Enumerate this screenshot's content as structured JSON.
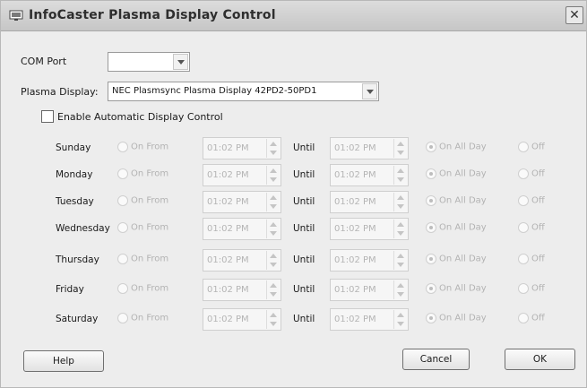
{
  "window": {
    "title": "InfoCaster Plasma Display Control",
    "close_label": "✕"
  },
  "com_port": {
    "label": "COM Port",
    "value": ""
  },
  "plasma_display": {
    "label": "Plasma Display:",
    "value": "NEC Plasmsync Plasma Display 42PD2-50PD1"
  },
  "enable_auto": {
    "label": "Enable Automatic Display Control",
    "checked": false
  },
  "schedule_labels": {
    "on_from": "On From",
    "until": "Until",
    "on_all_day": "On All Day",
    "off": "Off"
  },
  "days": [
    {
      "name": "Sunday",
      "from": "01:02 PM",
      "until": "01:02 PM",
      "mode": "on_all_day"
    },
    {
      "name": "Monday",
      "from": "01:02 PM",
      "until": "01:02 PM",
      "mode": "on_all_day"
    },
    {
      "name": "Tuesday",
      "from": "01:02 PM",
      "until": "01:02 PM",
      "mode": "on_all_day"
    },
    {
      "name": "Wednesday",
      "from": "01:02 PM",
      "until": "01:02 PM",
      "mode": "on_all_day"
    },
    {
      "name": "Thursday",
      "from": "01:02 PM",
      "until": "01:02 PM",
      "mode": "on_all_day"
    },
    {
      "name": "Friday",
      "from": "01:02 PM",
      "until": "01:02 PM",
      "mode": "on_all_day"
    },
    {
      "name": "Saturday",
      "from": "01:02 PM",
      "until": "01:02 PM",
      "mode": "on_all_day"
    }
  ],
  "buttons": {
    "help": "Help",
    "cancel": "Cancel",
    "ok": "OK"
  }
}
